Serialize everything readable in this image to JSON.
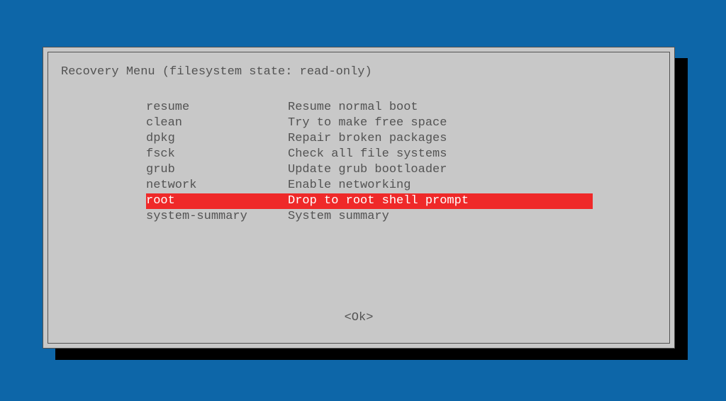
{
  "title": "Recovery Menu (filesystem state: read-only)",
  "menu": {
    "items": [
      {
        "key": "resume",
        "desc": "Resume normal boot",
        "selected": false
      },
      {
        "key": "clean",
        "desc": "Try to make free space",
        "selected": false
      },
      {
        "key": "dpkg",
        "desc": "Repair broken packages",
        "selected": false
      },
      {
        "key": "fsck",
        "desc": "Check all file systems",
        "selected": false
      },
      {
        "key": "grub",
        "desc": "Update grub bootloader",
        "selected": false
      },
      {
        "key": "network",
        "desc": "Enable networking",
        "selected": false
      },
      {
        "key": "root",
        "desc": "Drop to root shell prompt",
        "selected": true
      },
      {
        "key": "system-summary",
        "desc": "System summary",
        "selected": false
      }
    ]
  },
  "ok_label": "<Ok>"
}
